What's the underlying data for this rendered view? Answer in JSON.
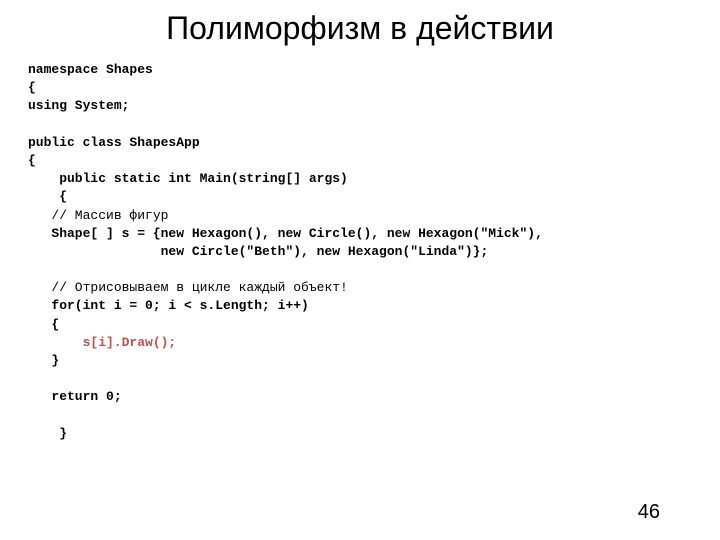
{
  "title": "Полиморфизм в действии",
  "code": {
    "l1": "namespace Shapes",
    "l2": "{",
    "l3": "using System;",
    "l4": "",
    "l5": "public class ShapesApp",
    "l6": "{",
    "l7": "    public static int Main(string[] args)",
    "l8": "    {",
    "l9": "   // Массив фигур",
    "l10": "   Shape[ ] s = {new Hexagon(), new Circle(), new Hexagon(\"Mick\"),",
    "l11": "                 new Circle(\"Beth\"), new Hexagon(\"Linda\")};",
    "l12": "",
    "l13": "   // Отрисовываем в цикле каждый объект!",
    "l14": "   for(int i = 0; i < s.Length; i++)",
    "l15": "   {",
    "l16": "       s[i].Draw();",
    "l17": "   }",
    "l18": "",
    "l19": "   return 0;",
    "l20": "",
    "l21": "    }"
  },
  "page_number": "46"
}
